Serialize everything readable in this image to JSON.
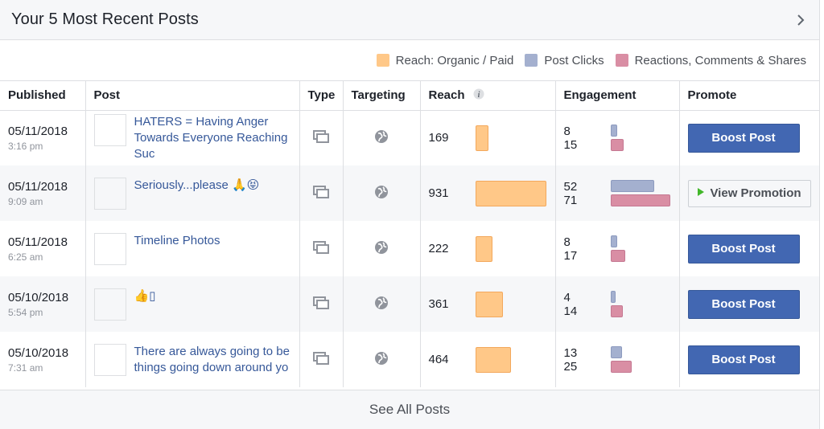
{
  "header": {
    "title": "Your 5 Most Recent Posts",
    "chevron_icon": "chevron-right-icon"
  },
  "legend": {
    "items": [
      {
        "label": "Reach: Organic / Paid",
        "color": "#ffc888"
      },
      {
        "label": "Post Clicks",
        "color": "#a4b0cf"
      },
      {
        "label": "Reactions, Comments & Shares",
        "color": "#d98ea4"
      }
    ]
  },
  "columns": {
    "published": "Published",
    "post": "Post",
    "type": "Type",
    "targeting": "Targeting",
    "reach": "Reach",
    "engagement": "Engagement",
    "promote": "Promote"
  },
  "rows": [
    {
      "date": "05/11/2018",
      "time": "3:16 pm",
      "post": "HATERS = Having Anger Towards Everyone Reaching Suc",
      "reach": 169,
      "clicks": 8,
      "reactions": 15,
      "promote": "Boost Post",
      "type_icon": "post-type-icon",
      "targeting_icon": "globe-icon"
    },
    {
      "date": "05/11/2018",
      "time": "9:09 am",
      "post": "Seriously...please 🙏😝",
      "reach": 931,
      "clicks": 52,
      "reactions": 71,
      "promote": "View Promotion",
      "type_icon": "post-type-icon",
      "targeting_icon": "globe-icon"
    },
    {
      "date": "05/11/2018",
      "time": "6:25 am",
      "post": "Timeline Photos",
      "reach": 222,
      "clicks": 8,
      "reactions": 17,
      "promote": "Boost Post",
      "type_icon": "post-type-icon",
      "targeting_icon": "globe-icon"
    },
    {
      "date": "05/10/2018",
      "time": "5:54 pm",
      "post": "👍▯",
      "reach": 361,
      "clicks": 4,
      "reactions": 14,
      "promote": "Boost Post",
      "type_icon": "post-type-icon",
      "targeting_icon": "globe-icon"
    },
    {
      "date": "05/10/2018",
      "time": "7:31 am",
      "post": "There are always going to be things going down around yo",
      "reach": 464,
      "clicks": 13,
      "reactions": 25,
      "promote": "Boost Post",
      "type_icon": "post-type-icon",
      "targeting_icon": "globe-icon"
    }
  ],
  "footer": {
    "label": "See All Posts"
  }
}
